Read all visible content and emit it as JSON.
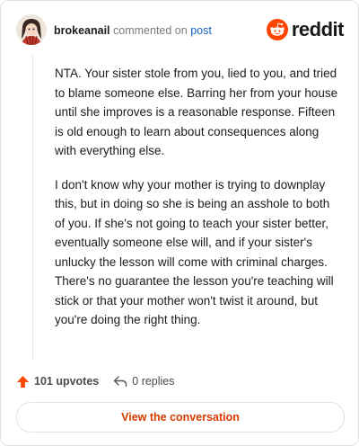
{
  "colors": {
    "accent": "#ff4500",
    "link": "#1565c0",
    "cta": "#d93a00",
    "text": "#1c1c1c"
  },
  "header": {
    "username": "brokeanail",
    "verb": "commented on",
    "target": "post",
    "brand": "reddit",
    "brand_icon": "reddit-alien-icon",
    "avatar_icon": "user-avatar-icon"
  },
  "comment": {
    "paragraphs": [
      "NTA. Your sister stole from you, lied to you, and tried to blame someone else. Barring her from your house until she improves is a reasonable response. Fifteen is old enough to learn about consequences along with everything else.",
      "I don't know why your mother is trying to downplay this, but in doing so she is being an asshole to both of you. If she's not going to teach your sister better, eventually someone else will, and if your sister's unlucky the lesson will come with criminal charges. There's no guarantee the lesson you're teaching will stick or that your mother won't twist it around, but you're doing the right thing."
    ]
  },
  "actions": {
    "upvotes": "101 upvotes",
    "replies": "0 replies",
    "upvote_icon": "upvote-arrow-icon",
    "reply_icon": "reply-arrow-icon"
  },
  "cta": {
    "label": "View the conversation"
  }
}
